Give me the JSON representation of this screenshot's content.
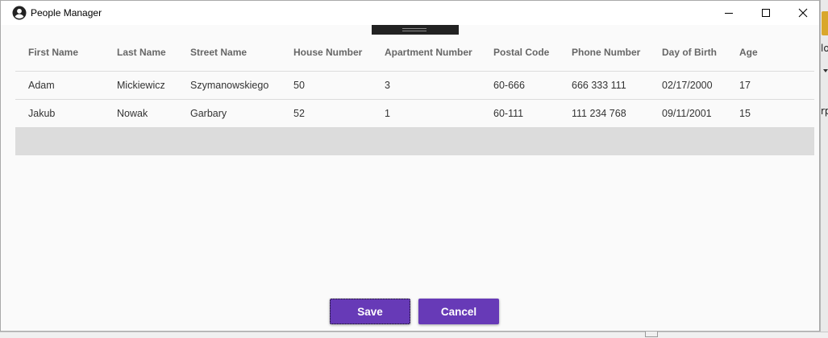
{
  "window": {
    "title": "People Manager",
    "icon": "account-circle-icon"
  },
  "table": {
    "headers": [
      "First Name",
      "Last Name",
      "Street Name",
      "House Number",
      "Apartment Number",
      "Postal Code",
      "Phone Number",
      "Day of Birth",
      "Age"
    ],
    "rows": [
      [
        "Adam",
        "Mickiewicz",
        "Szymanowskiego",
        "50",
        "3",
        "60-666",
        "666 333 111",
        "02/17/2000",
        "17"
      ],
      [
        "Jakub",
        "Nowak",
        "Garbary",
        "52",
        "1",
        "60-111",
        "111 234 768",
        "09/11/2001",
        "15"
      ]
    ]
  },
  "buttons": {
    "save_label": "Save",
    "cancel_label": "Cancel"
  },
  "background_window": {
    "text1": "lo",
    "text2": "rp"
  },
  "colors": {
    "accent": "#673ab7",
    "new_row": "#dcdcdc"
  }
}
